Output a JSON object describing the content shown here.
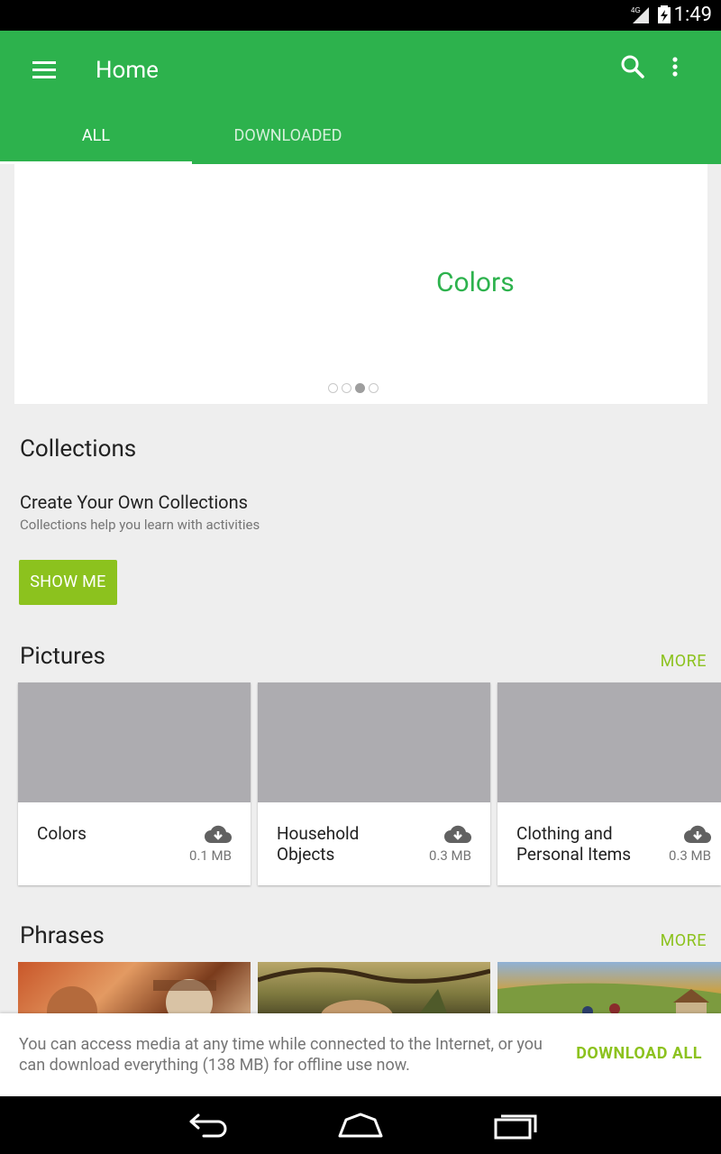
{
  "status_bar": {
    "network": "4G",
    "time": "1:49"
  },
  "app_bar": {
    "title": "Home",
    "tabs": [
      {
        "label": "ALL",
        "active": true
      },
      {
        "label": "DOWNLOADED",
        "active": false
      }
    ]
  },
  "hero": {
    "label": "Colors",
    "pager": {
      "count": 4,
      "active_index": 2
    }
  },
  "collections": {
    "title": "Collections",
    "heading": "Create Your Own Collections",
    "subtitle": "Collections help you learn with activities",
    "button_label": "SHOW ME"
  },
  "pictures": {
    "title": "Pictures",
    "more_label": "MORE",
    "items": [
      {
        "name": "Colors",
        "size": "0.1 MB"
      },
      {
        "name": "Household Objects",
        "size": "0.3 MB"
      },
      {
        "name": "Clothing and Personal Items",
        "size": "0.3 MB"
      }
    ]
  },
  "phrases": {
    "title": "Phrases",
    "more_label": "MORE"
  },
  "snackbar": {
    "message": "You can access media at any time while connected to the Internet, or you can download everything (138 MB) for offline use now.",
    "action_label": "DOWNLOAD ALL"
  },
  "colors": {
    "primary": "#2db24d",
    "accent": "#8cc21e",
    "placeholder": "#adacb0"
  }
}
